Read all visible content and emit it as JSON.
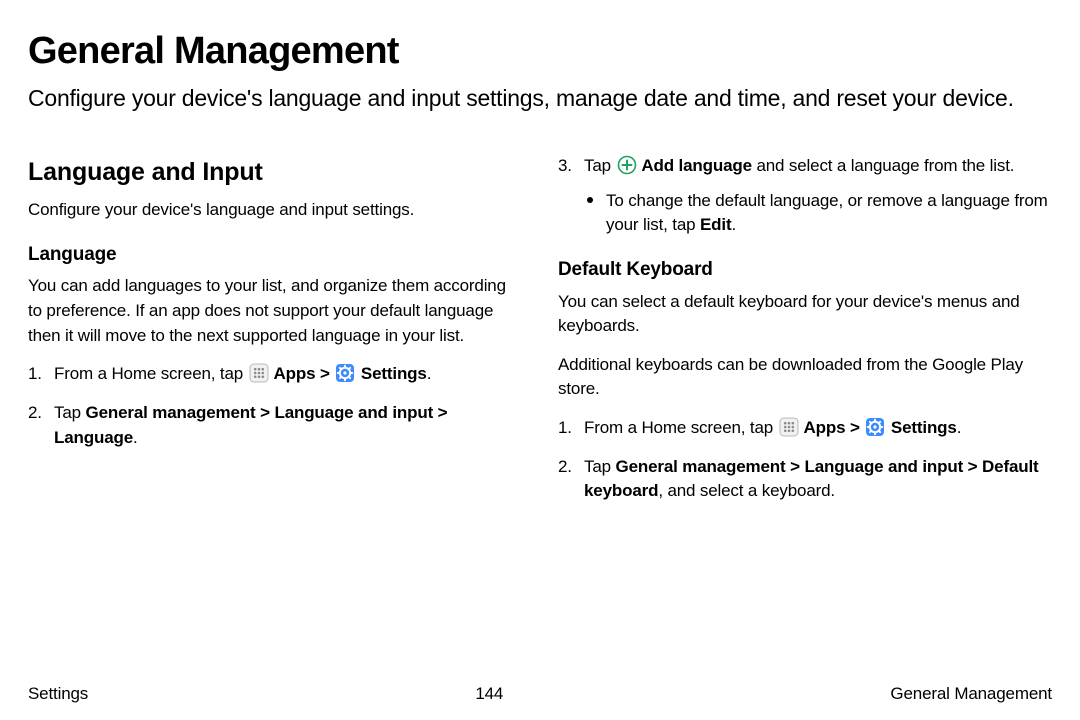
{
  "title": "General Management",
  "intro": "Configure your device's language and input settings, manage date and time, and reset your device.",
  "left": {
    "h2": "Language and Input",
    "sub": "Configure your device's language and input settings.",
    "h3": "Language",
    "langDesc": "You can add languages to your list, and organize them according to preference. If an app does not support your default language then it will move to the next supported language in your list.",
    "step1_a": "From a Home screen, tap ",
    "step1_apps": " Apps",
    "step1_settings": " Settings",
    "step2_a": "Tap ",
    "step2_b": "General management",
    "step2_c": "Language and input",
    "step2_d": "Language"
  },
  "right": {
    "step3_a": "Tap ",
    "step3_b": " Add language",
    "step3_c": " and select a language from the list.",
    "bullet_a": "To change the default language, or remove a language from your list, tap ",
    "bullet_b": "Edit",
    "h3": "Default Keyboard",
    "kbDesc1": "You can select a default keyboard for your device's menus and keyboards.",
    "kbDesc2": "Additional keyboards can be downloaded from the Google Play store.",
    "step1_a": "From a Home screen, tap ",
    "step1_apps": " Apps",
    "step1_settings": " Settings",
    "step2_a": "Tap ",
    "step2_b": "General management",
    "step2_c": "Language and input",
    "step2_d": "Default keyboard",
    "step2_e": ", and select a keyboard."
  },
  "footer": {
    "left": "Settings",
    "center": "144",
    "right": "General Management"
  },
  "chev": ">"
}
